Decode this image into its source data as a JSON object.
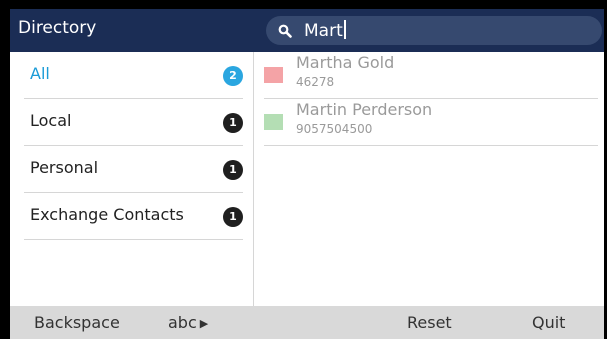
{
  "header": {
    "title": "Directory",
    "search_value": "Mart"
  },
  "categories": [
    {
      "label": "All",
      "count": "2",
      "active": true
    },
    {
      "label": "Local",
      "count": "1"
    },
    {
      "label": "Personal",
      "count": "1"
    },
    {
      "label": "Exchange Contacts",
      "count": "1"
    }
  ],
  "contacts": [
    {
      "name": "Martha Gold",
      "number": "46278",
      "color": "#f4a3a6"
    },
    {
      "name": "Martin Perderson",
      "number": "9057504500",
      "color": "#b4deb4"
    }
  ],
  "softkeys": {
    "backspace": "Backspace",
    "abc": "abc",
    "abc_arrow": "▶",
    "reset": "Reset",
    "quit": "Quit"
  },
  "colors": {
    "header_bg": "#1b2d55",
    "search_bg": "#36496f",
    "active_accent": "#1a9bd7",
    "softkey_bar": "#d9d9d9"
  }
}
